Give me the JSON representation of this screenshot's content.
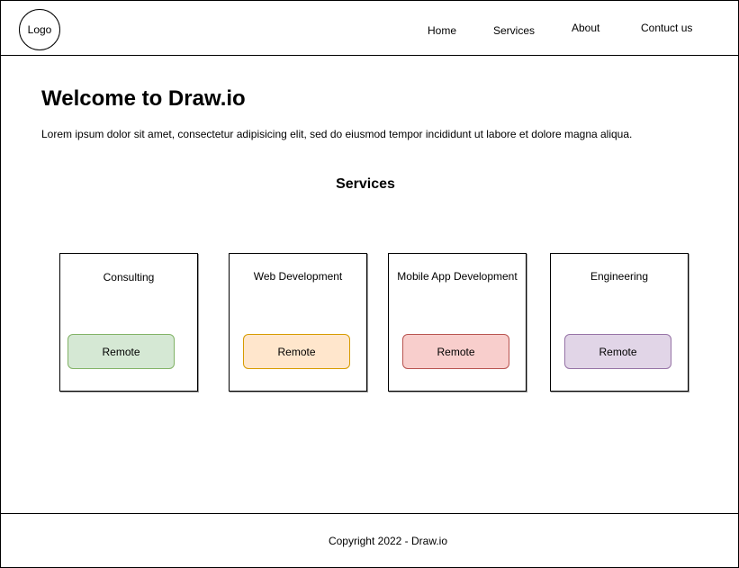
{
  "header": {
    "logo": "Logo",
    "nav": [
      "Home",
      "Services",
      "About",
      "Contuct us"
    ]
  },
  "main": {
    "title": "Welcome to Draw.io",
    "intro": "Lorem ipsum dolor sit amet, consectetur adipisicing elit, sed do eiusmod tempor incididunt ut labore et dolore magna aliqua.",
    "services_heading": "Services",
    "services": [
      {
        "title": "Consulting",
        "button": "Remote",
        "fill": "#d5e8d4",
        "stroke": "#82b366"
      },
      {
        "title": "Web Development",
        "button": "Remote",
        "fill": "#ffe6cc",
        "stroke": "#d79b00"
      },
      {
        "title": "Mobile App Development",
        "button": "Remote",
        "fill": "#f8cecc",
        "stroke": "#b85450"
      },
      {
        "title": "Engineering",
        "button": "Remote",
        "fill": "#e1d5e7",
        "stroke": "#9673a6"
      }
    ]
  },
  "footer": {
    "copyright": "Copyright 2022 - Draw.io"
  }
}
